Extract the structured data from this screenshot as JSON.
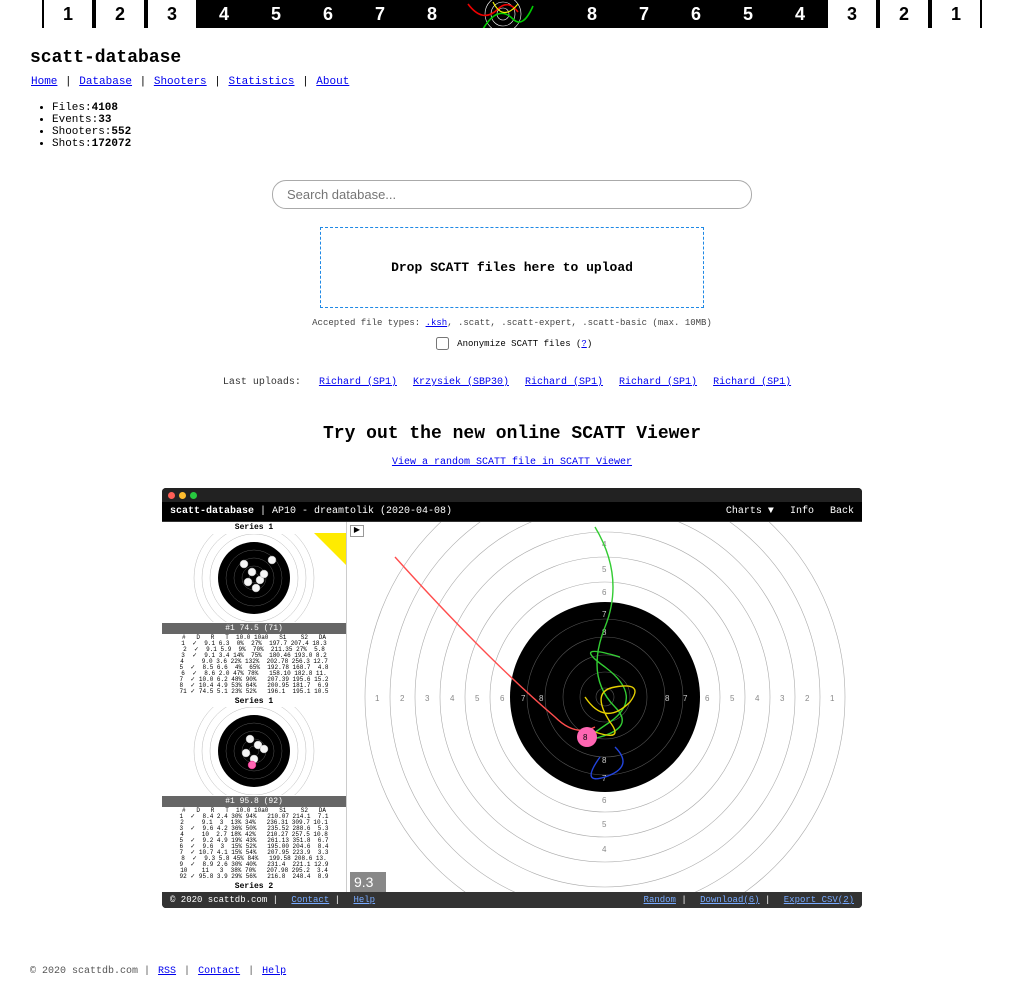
{
  "banner": {
    "left": [
      "1",
      "2",
      "3",
      "4",
      "5",
      "6",
      "7",
      "8"
    ],
    "right": [
      "8",
      "7",
      "6",
      "5",
      "4",
      "3",
      "2",
      "1"
    ]
  },
  "site_title": "scatt-database",
  "nav": [
    "Home",
    "Database",
    "Shooters",
    "Statistics",
    "About"
  ],
  "stats": {
    "files_label": "Files:",
    "files": "4108",
    "events_label": "Events:",
    "events": "33",
    "shooters_label": "Shooters:",
    "shooters": "552",
    "shots_label": "Shots:",
    "shots": "172072"
  },
  "search": {
    "placeholder": "Search database..."
  },
  "dropzone": {
    "label": "Drop SCATT files here to upload"
  },
  "accepted": {
    "prefix": "Accepted file types: ",
    "link": ".ksh",
    "suffix": ", .scatt, .scatt-expert, .scatt-basic (max. 10MB)"
  },
  "anonymize": {
    "label": "Anonymize SCATT files (",
    "qm": "?",
    "close": ")"
  },
  "uploads": {
    "label": "Last uploads:",
    "items": [
      "Richard (SP1)",
      "Krzysiek (SBP30)",
      "Richard (SP1)",
      "Richard (SP1)",
      "Richard (SP1)"
    ]
  },
  "viewer": {
    "heading": "Try out the new online SCATT Viewer",
    "link": "View a random SCATT file in SCATT Viewer"
  },
  "preview": {
    "brand": "scatt-database",
    "sep": " | ",
    "title": "AP10 - dreamtolik (2020-04-08)",
    "menu": {
      "charts": "Charts ▼",
      "info": "Info",
      "back": "Back"
    },
    "series1": "Series 1",
    "score1": "#1 74.5 (71)",
    "table1": "#   D   R   T  10.0 10a0   S1    S2   DA\n1  ✓  9.1 6.3  0%  27%  197.7 207.4 18.3\n2  ✓  9.1 5.9  9%  70%  211.35 27%  5.8\n3  ✓  9.1 3.4 14%  75%  180.46 193.0 8.2\n4     9.0 3.6 22% 132%  202.78 256.3 12.7\n5  ✓  8.5 6.6  4%  65%  192.78 168.7  4.8\n6  ✓  8.6 2.0 47% 78%   158.10 182.8 11.\n7  ✓ 10.0 6.2 48% 90%   207.39 195.6 15.2\n8  ✓ 10.4 4.9 53% 64%   200.95 181.7  6.9\n71 ✓ 74.5 5.1 23% 52%   196.1  195.1 10.5",
    "series1b": "Series 1",
    "score2": "#1 95.8 (92)",
    "table2": "#   D   R   T  10.0 10a0   S1    S2   DA\n1  ✓  8.4 2.4 30% 94%   210.07 214.1  7.1\n2     9.1  3  13% 34%   236.31 309.7 10.1\n3  ✓  9.6 4.2 36% 50%   235.52 288.6  5.3\n4     10  2.7 18% 42%   210.27 257.5 10.8\n5  ✓  9.2 4.9 19% 43%   261.13 351.8  6.7\n6  ✓  9.6  3  15% 52%   195.00 204.6  8.4\n7  ✓ 10.7 4.1 15% 54%   207.95 223.9  3.3\n8  ✓  9.3 5.8 45% 84%   199.58 208.6 13.\n9  ✓  8.9 2.6 30% 40%   231.4  221.1 12.9\n10    11   3  38% 70%   207.98 295.2  3.4\n92 ✓ 95.8 3.9 29% 56%   216.8  248.4  8.9",
    "series2": "Series 2",
    "big_score": "9.3",
    "footer": {
      "copy": "© 2020 scattdb.com | ",
      "contact": "Contact",
      "help": "Help",
      "random": "Random",
      "download": "Download(6)",
      "export": "Export CSV(2)"
    }
  },
  "page_footer": {
    "copy": "© 2020 scattdb.com | ",
    "rss": "RSS",
    "contact": "Contact",
    "help": "Help"
  }
}
